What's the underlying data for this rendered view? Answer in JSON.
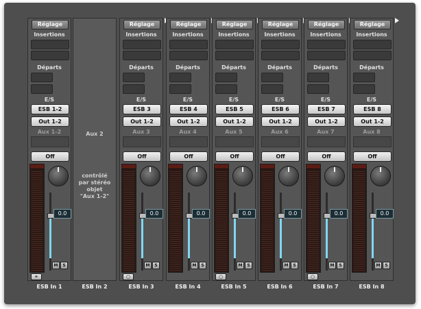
{
  "labels": {
    "setting": "Réglage",
    "inserts": "Insertions",
    "sends": "Départs",
    "io": "E/S",
    "off": "Off",
    "mute": "M",
    "solo": "S",
    "volume": "0.0"
  },
  "strips": [
    {
      "input": "ESB 1-2",
      "output": "Out 1-2",
      "aux": "Aux 1-2",
      "name": "ESB In 1",
      "input_mode": "stereo-link"
    },
    {
      "name": "ESB In 2",
      "aux_title": "Aux 2",
      "note": [
        "contrôlé",
        "par stéréo",
        "objet",
        "\"Aux 1-2\""
      ]
    },
    {
      "input": "ESB 3",
      "output": "Out 1-2",
      "aux": "Aux 3",
      "name": "ESB In 3",
      "input_mode": "mono"
    },
    {
      "input": "ESB 4",
      "output": "Out 1-2",
      "aux": "Aux 4",
      "name": "ESB In 4"
    },
    {
      "input": "ESB 5",
      "output": "Out 1-2",
      "aux": "Aux 5",
      "name": "ESB In 5",
      "input_mode": "mono"
    },
    {
      "input": "ESB 6",
      "output": "Out 1-2",
      "aux": "Aux 6",
      "name": "ESB In 6"
    },
    {
      "input": "ESB 7",
      "output": "Out 1-2",
      "aux": "Aux 7",
      "name": "ESB In 7",
      "input_mode": "mono"
    },
    {
      "input": "ESB 8",
      "output": "Out 1-2",
      "aux": "Aux 8",
      "name": "ESB In 8"
    }
  ],
  "colors": {
    "background": "#4e4e4e",
    "fader_level": "#7fd7f5",
    "meter_peak": "#5a1c14"
  }
}
